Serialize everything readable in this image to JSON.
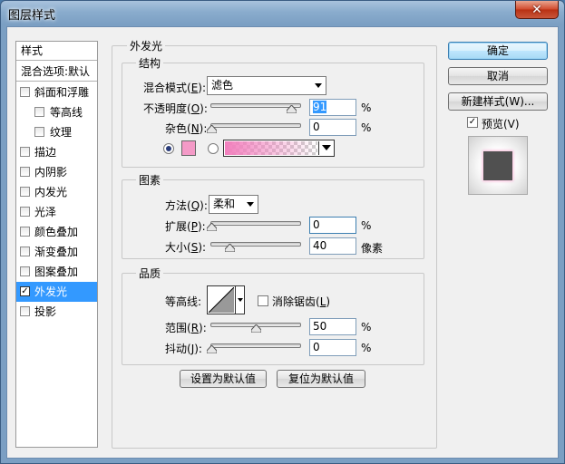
{
  "window": {
    "title": "图层样式",
    "close_glyph": "✕"
  },
  "left_panel": {
    "header": "样式",
    "blend_options": "混合选项:默认",
    "items": [
      {
        "label": "斜面和浮雕",
        "checked": false
      },
      {
        "label": "等高线",
        "checked": false
      },
      {
        "label": "纹理",
        "checked": false
      },
      {
        "label": "描边",
        "checked": false
      },
      {
        "label": "内阴影",
        "checked": false
      },
      {
        "label": "内发光",
        "checked": false
      },
      {
        "label": "光泽",
        "checked": false
      },
      {
        "label": "颜色叠加",
        "checked": false
      },
      {
        "label": "渐变叠加",
        "checked": false
      },
      {
        "label": "图案叠加",
        "checked": false
      },
      {
        "label": "外发光",
        "checked": true,
        "selected": true
      },
      {
        "label": "投影",
        "checked": false
      }
    ]
  },
  "outer_glow": {
    "title": "外发光",
    "structure": {
      "title": "结构",
      "blend_mode_label": "混合模式(",
      "blend_mode_key": "E",
      "blend_mode_value": "滤色",
      "opacity_label": "不透明度(",
      "opacity_key": "O",
      "opacity_value": "91",
      "opacity_level": 0.91,
      "noise_label": "杂色(",
      "noise_key": "N",
      "noise_value": "0",
      "noise_level": 0,
      "percent": "%",
      "glow_color": "#f49ac7",
      "gradient_from": "#f27fbd"
    },
    "elements": {
      "title": "图素",
      "technique_label": "方法(",
      "technique_key": "Q",
      "technique_value": "柔和",
      "spread_label": "扩展(",
      "spread_key": "P",
      "spread_value": "0",
      "spread_level": 0,
      "size_label": "大小(",
      "size_key": "S",
      "size_value": "40",
      "size_level": 0.16,
      "percent": "%",
      "pixels": "像素"
    },
    "quality": {
      "title": "品质",
      "contour_label": "等高线:",
      "antialias_label": "消除锯齿(",
      "antialias_key": "L",
      "antialias_checked": false,
      "range_label": "范围(",
      "range_key": "R",
      "range_value": "50",
      "range_level": 0.5,
      "jitter_label": "抖动(",
      "jitter_key": "J",
      "jitter_value": "0",
      "jitter_level": 0,
      "percent": "%"
    },
    "make_default": "设置为默认值",
    "reset_default": "复位为默认值"
  },
  "right_panel": {
    "ok": "确定",
    "cancel": "取消",
    "new_style": "新建样式(W)...",
    "preview_label": "预览(V)",
    "preview_checked": true
  },
  "colors": {
    "selection": "#3399ff",
    "swatch": "#f49ac7"
  }
}
